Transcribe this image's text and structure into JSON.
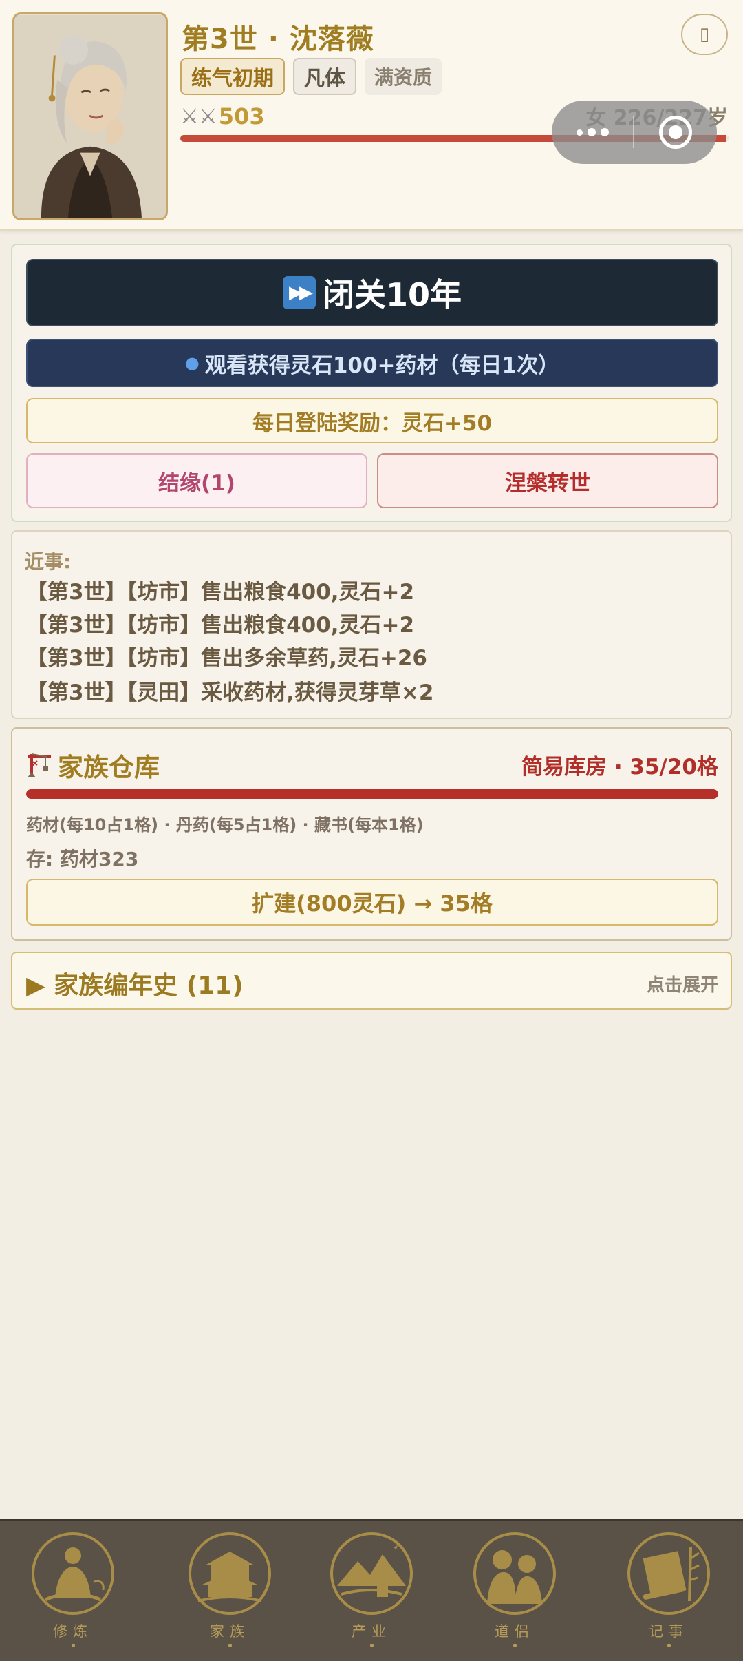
{
  "header": {
    "title": "第3世 · 沈落薇",
    "round_button_icon": "info-icon",
    "tags": [
      "练气初期",
      "凡体",
      "满资质"
    ],
    "power_value": "503",
    "age_text": "女 226/227岁",
    "life_fraction": 0.995
  },
  "actions": {
    "seclusion_label": "闭关10年",
    "ad_label": "观看获得灵石100+药材（每日1次）",
    "daily_label": "每日登陆奖励：灵石+50",
    "marry_label": "结缘(1)",
    "rebirth_label": "涅槃转世"
  },
  "news": {
    "label": "近事:",
    "items": [
      "【第3世】【坊市】售出粮食400,灵石+2",
      "【第3世】【坊市】售出粮食400,灵石+2",
      "【第3世】【坊市】售出多余草药,灵石+26",
      "【第3世】【灵田】采收药材,获得灵芽草×2"
    ]
  },
  "warehouse": {
    "title": "家族仓库",
    "capacity": "简易库房 · 35/20格",
    "fill_fraction": 1.0,
    "rules": "药材(每10占1格) · 丹药(每5占1格) · 藏书(每本1格)",
    "stock": "存: 药材323",
    "expand_label": "扩建(800灵石) → 35格"
  },
  "chronicle": {
    "title": "▶ 家族编年史 (11)",
    "hint": "点击展开"
  },
  "nav": {
    "items": [
      {
        "label": "修炼",
        "icon": "meditation-icon"
      },
      {
        "label": "家族",
        "icon": "clan-house-icon"
      },
      {
        "label": "产业",
        "icon": "mountain-estate-icon"
      },
      {
        "label": "道侣",
        "icon": "couple-icon"
      },
      {
        "label": "记事",
        "icon": "scroll-icon"
      }
    ]
  },
  "colors": {
    "accent_gold": "#a07d20",
    "primary_dark": "#1d2a35",
    "danger_red": "#b6302a",
    "nav_bg": "#5b5247"
  }
}
